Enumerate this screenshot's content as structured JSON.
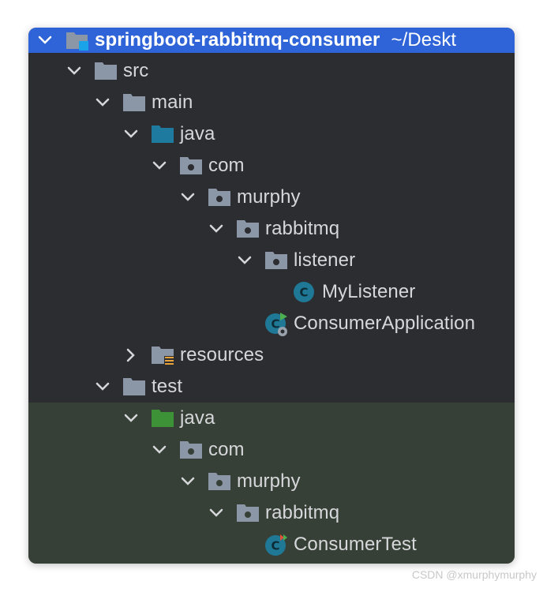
{
  "tree": {
    "root": {
      "name": "springboot-rabbitmq-consumer",
      "path": "~/Deskt"
    },
    "items": [
      {
        "label": "src"
      },
      {
        "label": "main"
      },
      {
        "label": "java"
      },
      {
        "label": "com"
      },
      {
        "label": "murphy"
      },
      {
        "label": "rabbitmq"
      },
      {
        "label": "listener"
      },
      {
        "label": "MyListener"
      },
      {
        "label": "ConsumerApplication"
      },
      {
        "label": "resources"
      },
      {
        "label": "test"
      },
      {
        "label": "java"
      },
      {
        "label": "com"
      },
      {
        "label": "murphy"
      },
      {
        "label": "rabbitmq"
      },
      {
        "label": "ConsumerTest"
      }
    ]
  },
  "colors": {
    "panel": "#2b2d30",
    "selection": "#2f64d8",
    "test_background": "#374036",
    "source_folder": "#1f7aa0",
    "test_folder": "#3d9136",
    "class_icon": "#1e7896"
  },
  "watermark": "CSDN @xmurphymurphy"
}
